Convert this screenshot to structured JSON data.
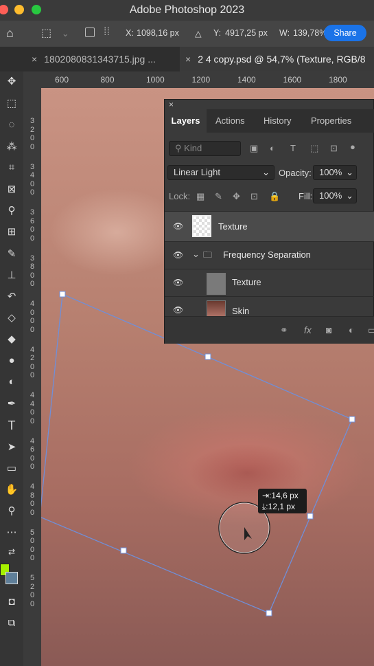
{
  "window": {
    "title": "Adobe Photoshop 2023",
    "traffic_colors": [
      "#fe5f57",
      "#febc2e",
      "#28c840"
    ]
  },
  "options_bar": {
    "x_label": "X:",
    "x_value": "1098,16 px",
    "y_label": "Y:",
    "y_value": "4917,25 px",
    "w_label": "W:",
    "w_value": "139,78%",
    "share_label": "Share"
  },
  "tabs": [
    {
      "label": "1802080831343715.jpg ...",
      "close": "×"
    },
    {
      "label": "2 4 copy.psd @ 54,7% (Texture, RGB/8",
      "close": "×"
    }
  ],
  "ruler": {
    "h_ticks": [
      "600",
      "800",
      "1000",
      "1200",
      "1400",
      "1600",
      "1800"
    ],
    "v_ticks": [
      "3200",
      "3400",
      "3600",
      "3800",
      "4000",
      "4200",
      "4400",
      "4600",
      "4800",
      "5000",
      "5200"
    ]
  },
  "layers_panel": {
    "tabs": [
      "Layers",
      "Actions",
      "History",
      "Properties"
    ],
    "kind_placeholder": "Kind",
    "blend_mode": "Linear Light",
    "opacity_label": "Opacity:",
    "opacity_value": "100%",
    "lock_label": "Lock:",
    "fill_label": "Fill:",
    "fill_value": "100%",
    "layers": [
      {
        "name": "Texture"
      },
      {
        "name": "Frequency Separation"
      },
      {
        "name": "Texture"
      },
      {
        "name": "Skin"
      }
    ]
  },
  "transform_readout": {
    "dx": "14,6 px",
    "dy": "12,1 px"
  },
  "colors": {
    "foreground": "#a6f000",
    "background": "#5f7f99",
    "transform_line": "#6f8fd9",
    "share_blue": "#1a73e8"
  }
}
